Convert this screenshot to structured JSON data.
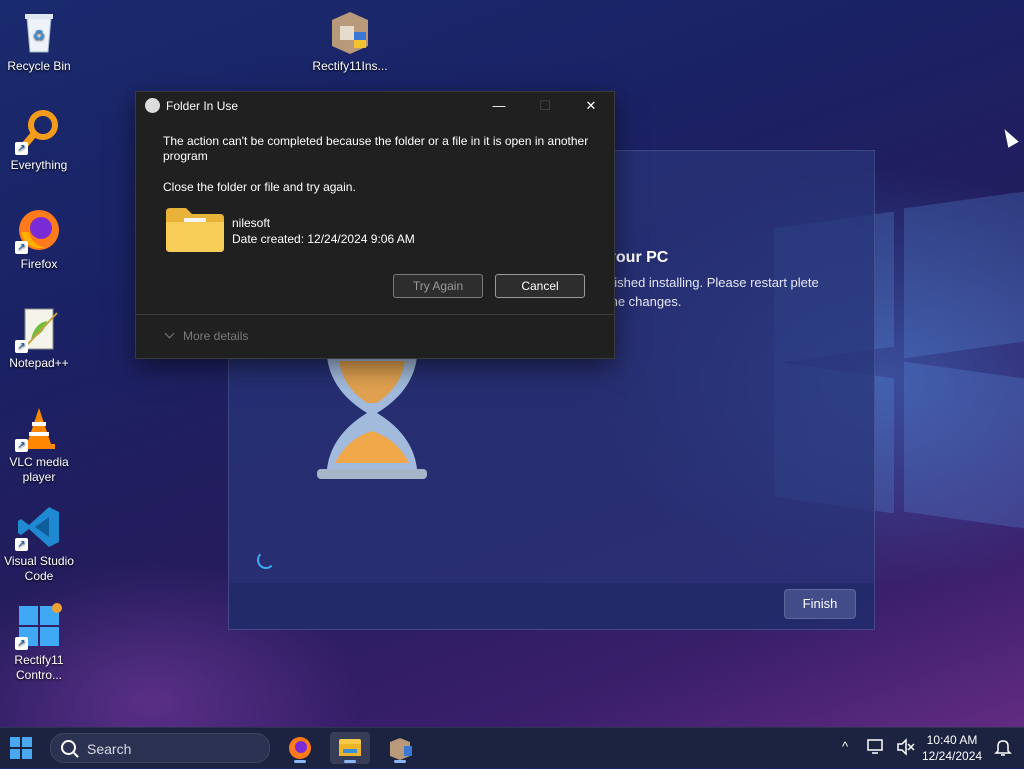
{
  "desktop_icons": [
    {
      "label": "Recycle Bin"
    },
    {
      "label": "Everything"
    },
    {
      "label": "Firefox"
    },
    {
      "label": "Notepad++"
    },
    {
      "label": "VLC media player"
    },
    {
      "label": "Visual Studio Code"
    },
    {
      "label": "Rectify11 Contro..."
    },
    {
      "label": "Rectify11Ins..."
    }
  ],
  "installer": {
    "heading": "your PC",
    "body": "nished installing. Please restart plete the changes.",
    "finish_label": "Finish"
  },
  "dialog": {
    "title": "Folder In Use",
    "message": "The action can't be completed because the folder or a file in it is open in another program",
    "instruction": "Close the folder or file and try again.",
    "file_name": "nilesoft",
    "file_date": "Date created: 12/24/2024 9:06 AM",
    "try_again_label": "Try Again",
    "cancel_label": "Cancel",
    "more_details_label": "More details",
    "minimize_glyph": "—",
    "maximize_glyph": "☐",
    "close_glyph": "✕"
  },
  "taskbar": {
    "search_label": "Search",
    "time": "10:40 AM",
    "date": "12/24/2024",
    "tray_chevron": "^"
  }
}
